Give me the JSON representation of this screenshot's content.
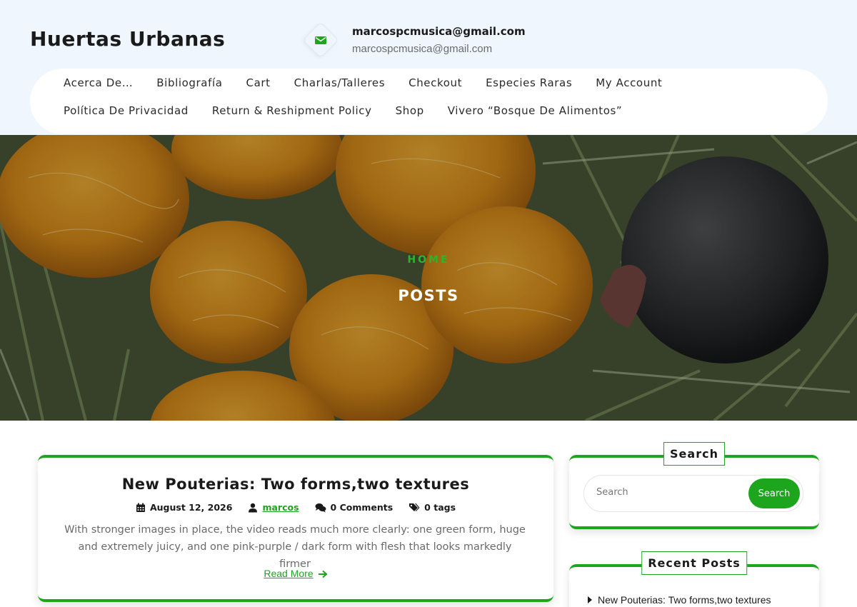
{
  "site": {
    "title": "Huertas Urbanas"
  },
  "contact": {
    "icon": "envelope-icon",
    "primary": "marcospcmusica@gmail.com",
    "secondary": "marcospcmusica@gmail.com"
  },
  "nav": {
    "row1": [
      "Acerca De…",
      "Bibliografía",
      "Cart",
      "Charlas/Talleres",
      "Checkout",
      "Especies Raras",
      "My Account"
    ],
    "row2": [
      "Política De Privacidad",
      "Return & Reshipment Policy",
      "Shop",
      "Vivero “Bosque De Alimentos”"
    ]
  },
  "hero": {
    "breadcrumb": "Home",
    "title": "POSTS"
  },
  "post": {
    "title": "New Pouterias: Two forms,two textures",
    "date": "August 12, 2026",
    "author": "marcos",
    "comments": "0 Comments",
    "tags": "0 tags",
    "excerpt": "With stronger images in place, the video reads much more clearly: one green form, huge and extremely juicy, and one pink-purple / dark form with flesh that looks markedly firmer",
    "read_more": "Read More"
  },
  "sidebar": {
    "search": {
      "title": "Search",
      "placeholder": "Search",
      "button": "Search"
    },
    "recent": {
      "title": "Recent Posts",
      "items": [
        "New Pouterias: Two forms,two textures"
      ]
    }
  },
  "colors": {
    "accent": "#1ea51e",
    "header_bg": "#eff6fd"
  }
}
